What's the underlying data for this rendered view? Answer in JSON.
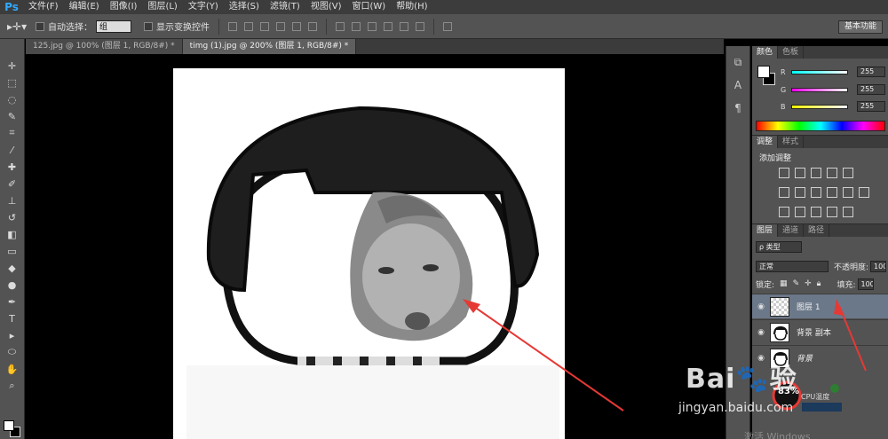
{
  "app": {
    "logo": "Ps"
  },
  "menu": [
    "文件(F)",
    "编辑(E)",
    "图像(I)",
    "图层(L)",
    "文字(Y)",
    "选择(S)",
    "滤镜(T)",
    "视图(V)",
    "窗口(W)",
    "帮助(H)"
  ],
  "options": {
    "auto_select_label": "自动选择：",
    "auto_select_value": "组",
    "show_transform_label": "显示变换控件",
    "workspace_label": "基本功能"
  },
  "tabs": [
    "125.jpg @ 100% (图层 1, RGB/8#) *",
    "timg (1).jpg @ 200% (图层 1, RGB/8#) *"
  ],
  "color_panel": {
    "tabs": [
      "颜色",
      "色板"
    ],
    "r_label": "R",
    "g_label": "G",
    "b_label": "B",
    "r_value": "255",
    "g_value": "255",
    "b_value": "255"
  },
  "adjust_panel": {
    "tabs": [
      "调整",
      "样式"
    ],
    "title": "添加调整"
  },
  "layers_panel": {
    "tabs": [
      "图层",
      "通道",
      "路径"
    ],
    "filter_value": "ρ 类型",
    "blend_mode": "正常",
    "opacity_label": "不透明度:",
    "opacity_value": "100",
    "lock_label": "锁定:",
    "fill_label": "填充:",
    "fill_value": "100",
    "layers": [
      {
        "name": "图层 1"
      },
      {
        "name": "背景 副本"
      },
      {
        "name": "背景"
      }
    ]
  },
  "overlay": {
    "cpu_percent": "83%",
    "cpu_label": "CPU温度",
    "watermark_logo": "Bai🐾验",
    "watermark_url": "jingyan.baidu.com",
    "windows_text": "激活 Windows"
  },
  "colors": {
    "accent": "#31a8ff",
    "arrow": "#e53935",
    "selected_layer": "#6b7889"
  }
}
